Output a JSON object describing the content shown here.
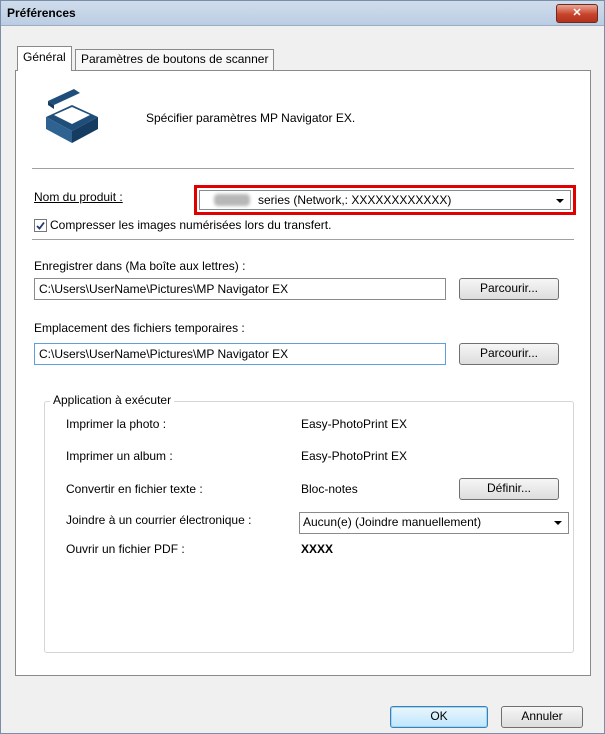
{
  "window": {
    "title": "Préférences",
    "close_label": "✕"
  },
  "tabs": [
    {
      "label": "Général"
    },
    {
      "label": "Paramètres de boutons de scanner"
    }
  ],
  "header": {
    "description": "Spécifier paramètres MP Navigator EX."
  },
  "product": {
    "label": "Nom du produit :",
    "value": "series (Network,: XXXXXXXXXXXX)"
  },
  "compress": {
    "label": "Compresser les images numérisées lors du transfert.",
    "checked": true
  },
  "save_in": {
    "label": "Enregistrer dans (Ma boîte aux lettres) :",
    "value": "C:\\Users\\UserName\\Pictures\\MP Navigator EX",
    "browse_label": "Parcourir..."
  },
  "temp": {
    "label": "Emplacement des fichiers temporaires :",
    "value": "C:\\Users\\UserName\\Pictures\\MP Navigator EX",
    "browse_label": "Parcourir..."
  },
  "apps": {
    "group_label": "Application à exécuter",
    "print_photo": {
      "label": "Imprimer la photo :",
      "value": "Easy-PhotoPrint EX"
    },
    "print_album": {
      "label": "Imprimer un album :",
      "value": "Easy-PhotoPrint EX"
    },
    "convert_text": {
      "label": "Convertir en fichier texte :",
      "value": "Bloc-notes",
      "button_label": "Définir..."
    },
    "attach_email": {
      "label": "Joindre à un courrier électronique :",
      "value": "Aucun(e) (Joindre manuellement)"
    },
    "open_pdf": {
      "label": "Ouvrir un fichier PDF :",
      "value": "XXXX"
    }
  },
  "footer": {
    "ok_label": "OK",
    "cancel_label": "Annuler"
  }
}
